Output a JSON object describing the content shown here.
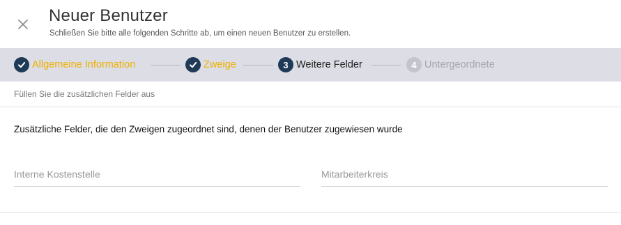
{
  "header": {
    "title": "Neuer Benutzer",
    "subtitle": "Schließen Sie bitte alle folgenden Schritte ab, um einen neuen Benutzer zu erstellen."
  },
  "stepper": {
    "steps": [
      {
        "label": "Allgemeine Information",
        "state": "done",
        "icon": "check-icon"
      },
      {
        "label": "Zweige",
        "state": "done",
        "icon": "check-icon"
      },
      {
        "label": "Weitere Felder",
        "state": "active",
        "number": "3"
      },
      {
        "label": "Untergeordnete",
        "state": "pending",
        "number": "4"
      }
    ],
    "colors": {
      "bar": "#dcdde5",
      "done_label": "#f0b000",
      "circle": "#1f3a57",
      "pending": "#c4c5cc"
    }
  },
  "hint": "Füllen Sie die zusätzlichen Felder aus",
  "section": {
    "title": "Zusätzliche Felder, die den Zweigen zugeordnet sind, denen der Benutzer zugewiesen wurde"
  },
  "fields": [
    {
      "placeholder": "Interne Kostenstelle",
      "value": ""
    },
    {
      "placeholder": "Mitarbeiterkreis",
      "value": ""
    }
  ]
}
